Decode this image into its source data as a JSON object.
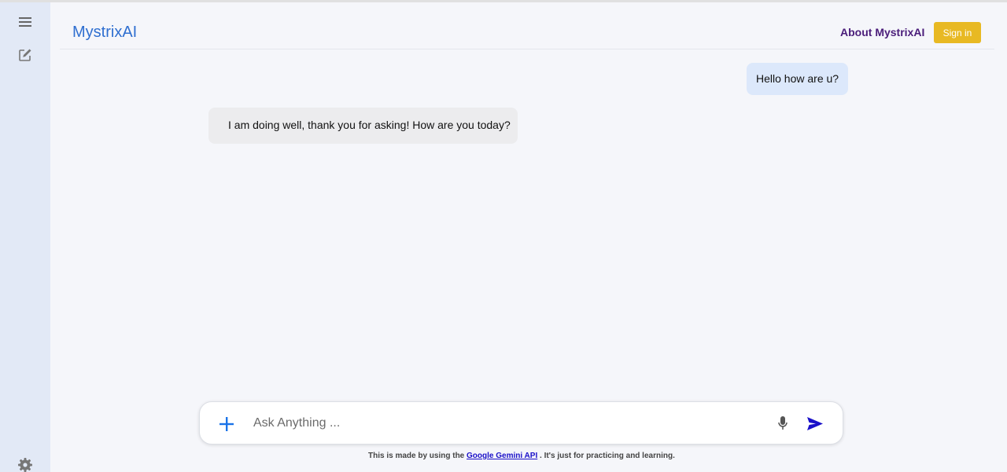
{
  "sidebar": {
    "menu_icon": "hamburger-menu-icon",
    "new_chat_icon": "edit-icon",
    "settings_icon": "gear-icon"
  },
  "header": {
    "logo": "MystrixAI",
    "about_label": "About MystrixAI",
    "signin_label": "Sign in"
  },
  "messages": [
    {
      "role": "user",
      "text": "Hello how are u?"
    },
    {
      "role": "assistant",
      "text": "I am doing well, thank you for asking! How are you today?"
    }
  ],
  "composer": {
    "placeholder": "Ask Anything ...",
    "value": "",
    "add_icon": "plus-icon",
    "mic_icon": "microphone-icon",
    "send_icon": "send-icon"
  },
  "footer": {
    "prefix": "This is made by using the",
    "link": "Google Gemini API",
    "suffix": ". It's just for practicing and learning."
  },
  "colors": {
    "sidebar_bg": "#e2e9f6",
    "page_bg": "#f5f6fa",
    "logo": "#2f6fd0",
    "about": "#4a1d7a",
    "signin_bg": "#e8b923",
    "user_bubble": "#dce8fb",
    "ai_bubble": "#ececee",
    "plus": "#1a73e8",
    "send": "#1a10c9"
  }
}
